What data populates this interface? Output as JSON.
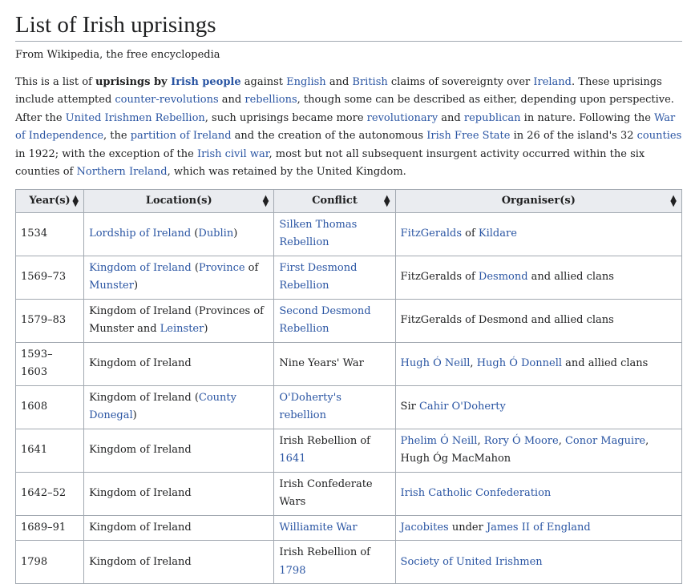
{
  "title": "List of Irish uprisings",
  "subtitle": "From Wikipedia, the free encyclopedia",
  "intro": [
    {
      "t": "This is a list of "
    },
    {
      "t": "uprisings by ",
      "b": true
    },
    {
      "t": "Irish people",
      "b": true,
      "a": true
    },
    {
      "t": " against "
    },
    {
      "t": "English",
      "a": true
    },
    {
      "t": " and "
    },
    {
      "t": "British",
      "a": true
    },
    {
      "t": " claims of sovereignty over "
    },
    {
      "t": "Ireland",
      "a": true
    },
    {
      "t": ". These uprisings include attempted "
    },
    {
      "t": "counter-revolutions",
      "a": true
    },
    {
      "t": " and "
    },
    {
      "t": "rebellions",
      "a": true
    },
    {
      "t": ", though some can be described as either, depending upon perspective. After the "
    },
    {
      "t": "United Irishmen Rebellion",
      "a": true
    },
    {
      "t": ", such uprisings became more "
    },
    {
      "t": "revolutionary",
      "a": true
    },
    {
      "t": " and "
    },
    {
      "t": "republican",
      "a": true
    },
    {
      "t": " in nature. Following the "
    },
    {
      "t": "War of Independence",
      "a": true
    },
    {
      "t": ", the "
    },
    {
      "t": "partition of Ireland",
      "a": true
    },
    {
      "t": " and the creation of the autonomous "
    },
    {
      "t": "Irish Free State",
      "a": true
    },
    {
      "t": " in 26 of the island's 32 "
    },
    {
      "t": "counties",
      "a": true
    },
    {
      "t": " in 1922; with the exception of the "
    },
    {
      "t": "Irish civil war",
      "a": true
    },
    {
      "t": ", most but not all subsequent insurgent activity occurred within the six counties of "
    },
    {
      "t": "Northern Ireland",
      "a": true
    },
    {
      "t": ", which was retained by the United Kingdom."
    }
  ],
  "table": {
    "headers": [
      "Year(s)",
      "Location(s)",
      "Conflict",
      "Organiser(s)"
    ],
    "sort_icon": "sort-arrows-icon",
    "rows": [
      {
        "year": "1534",
        "loc": [
          {
            "t": "Lordship of Ireland",
            "a": true
          },
          {
            "t": " ("
          },
          {
            "t": "Dublin",
            "a": true
          },
          {
            "t": ")"
          }
        ],
        "conf": [
          {
            "t": "Silken Thomas Rebellion",
            "a": true
          }
        ],
        "org": [
          {
            "t": "FitzGeralds",
            "a": true
          },
          {
            "t": " of "
          },
          {
            "t": "Kildare",
            "a": true
          }
        ]
      },
      {
        "year": "1569–73",
        "loc": [
          {
            "t": "Kingdom of Ireland",
            "a": true
          },
          {
            "t": " ("
          },
          {
            "t": "Province",
            "a": true
          },
          {
            "t": " of "
          },
          {
            "t": "Munster",
            "a": true
          },
          {
            "t": ")"
          }
        ],
        "conf": [
          {
            "t": "First Desmond Rebellion",
            "a": true
          }
        ],
        "org": [
          {
            "t": "FitzGeralds of "
          },
          {
            "t": "Desmond",
            "a": true
          },
          {
            "t": " and allied clans"
          }
        ]
      },
      {
        "year": "1579–83",
        "loc": [
          {
            "t": "Kingdom of Ireland (Provinces of Munster and "
          },
          {
            "t": "Leinster",
            "a": true
          },
          {
            "t": ")"
          }
        ],
        "conf": [
          {
            "t": "Second Desmond Rebellion",
            "a": true
          }
        ],
        "org": [
          {
            "t": "FitzGeralds of Desmond and allied clans"
          }
        ]
      },
      {
        "year": "1593–1603",
        "loc": [
          {
            "t": "Kingdom of Ireland"
          }
        ],
        "conf": [
          {
            "t": "Nine Years' War"
          }
        ],
        "org": [
          {
            "t": "Hugh Ó Neill",
            "a": true
          },
          {
            "t": ", "
          },
          {
            "t": "Hugh Ó Donnell",
            "a": true
          },
          {
            "t": " and allied clans"
          }
        ]
      },
      {
        "year": "1608",
        "loc": [
          {
            "t": "Kingdom of Ireland ("
          },
          {
            "t": "County Donegal",
            "a": true
          },
          {
            "t": ")"
          }
        ],
        "conf": [
          {
            "t": "O'Doherty's rebellion",
            "a": true
          }
        ],
        "org": [
          {
            "t": "Sir "
          },
          {
            "t": "Cahir O'Doherty",
            "a": true
          }
        ]
      },
      {
        "year": "1641",
        "loc": [
          {
            "t": "Kingdom of Ireland"
          }
        ],
        "conf": [
          {
            "t": "Irish Rebellion of "
          },
          {
            "t": "1641",
            "a": true
          }
        ],
        "org": [
          {
            "t": "Phelim Ó Neill",
            "a": true
          },
          {
            "t": ", "
          },
          {
            "t": "Rory Ó Moore",
            "a": true
          },
          {
            "t": ", "
          },
          {
            "t": "Conor Maguire",
            "a": true
          },
          {
            "t": ", Hugh Óg MacMahon"
          }
        ]
      },
      {
        "year": "1642–52",
        "loc": [
          {
            "t": "Kingdom of Ireland"
          }
        ],
        "conf": [
          {
            "t": "Irish Confederate Wars"
          }
        ],
        "org": [
          {
            "t": "Irish Catholic Confederation",
            "a": true
          }
        ]
      },
      {
        "year": "1689–91",
        "loc": [
          {
            "t": "Kingdom of Ireland"
          }
        ],
        "conf": [
          {
            "t": "Williamite War",
            "a": true
          }
        ],
        "org": [
          {
            "t": "Jacobites",
            "a": true
          },
          {
            "t": " under "
          },
          {
            "t": "James II of England",
            "a": true
          }
        ]
      },
      {
        "year": "1798",
        "loc": [
          {
            "t": "Kingdom of Ireland"
          }
        ],
        "conf": [
          {
            "t": "Irish Rebellion of "
          },
          {
            "t": "1798",
            "a": true
          }
        ],
        "org": [
          {
            "t": "Society of United Irishmen",
            "a": true
          }
        ]
      }
    ]
  }
}
